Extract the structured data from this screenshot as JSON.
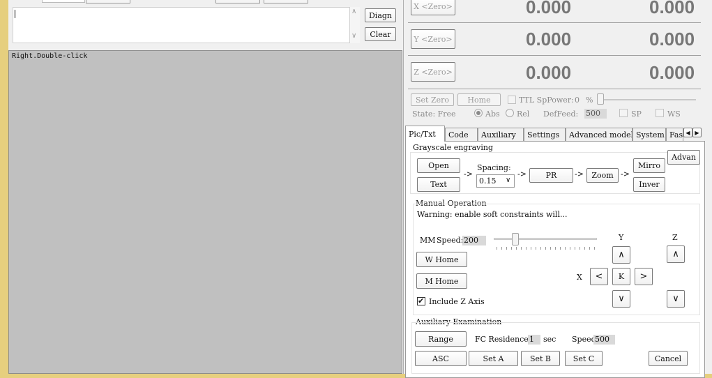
{
  "left": {
    "diag_button": "Diagn",
    "clear_button": "Clear",
    "log_text": "Right.Double-click"
  },
  "axes": [
    {
      "zero_button": "X <Zero>",
      "work": "0.000",
      "machine": "0.000"
    },
    {
      "zero_button": "Y <Zero>",
      "work": "0.000",
      "machine": "0.000"
    },
    {
      "zero_button": "Z <Zero>",
      "work": "0.000",
      "machine": "0.000"
    }
  ],
  "controls": {
    "set_zero": "Set Zero",
    "home": "Home",
    "ttl_label": "TTL SpPower:",
    "ttl_value": "0",
    "ttl_unit": "%",
    "state_label": "State: Free",
    "abs_label": "Abs",
    "rel_label": "Rel",
    "deffeed_label": "DefFeed:",
    "deffeed_value": "500",
    "sp_label": "SP",
    "ws_label": "WS",
    "abs_selected": true
  },
  "tabs": [
    "Pic/Txt",
    "Code",
    "Auxiliary",
    "Settings",
    "Advanced model",
    "System",
    "Fas"
  ],
  "grayscale": {
    "title": "Grayscale engraving",
    "open": "Open",
    "text": "Text",
    "spacing_label": "Spacing:",
    "spacing_value": "0.15",
    "pr": "PR",
    "zoom": "Zoom",
    "mirror": "Mirro",
    "invert": "Inver",
    "advan": "Advan",
    "arrow": "->"
  },
  "manual": {
    "title": "Manual Operation",
    "warning": "Warning: enable soft constraints will...",
    "mm_label": "MM",
    "speed_label": "Speed:",
    "speed_value": "200",
    "speed_slider_fraction": 0.19,
    "w_home": "W Home",
    "m_home": "M Home",
    "include_z": "Include Z Axis",
    "include_z_checked": true,
    "y_label": "Y",
    "z_label": "Z",
    "x_label": "X",
    "k_button": "K"
  },
  "aux": {
    "title": "Auxiliary Examination",
    "range": "Range",
    "fc_label": "FC Residence",
    "fc_value": "1",
    "sec": "sec",
    "speed_label": "Speed",
    "speed_value": "500",
    "asc": "ASC",
    "set_a": "Set A",
    "set_b": "Set B",
    "set_c": "Set C",
    "cancel": "Cancel"
  },
  "colors": {
    "window_bg": "#e6cf7e",
    "panel": "#f0f0f0",
    "canvas": "#c0c0c0",
    "digits": "#777777"
  }
}
